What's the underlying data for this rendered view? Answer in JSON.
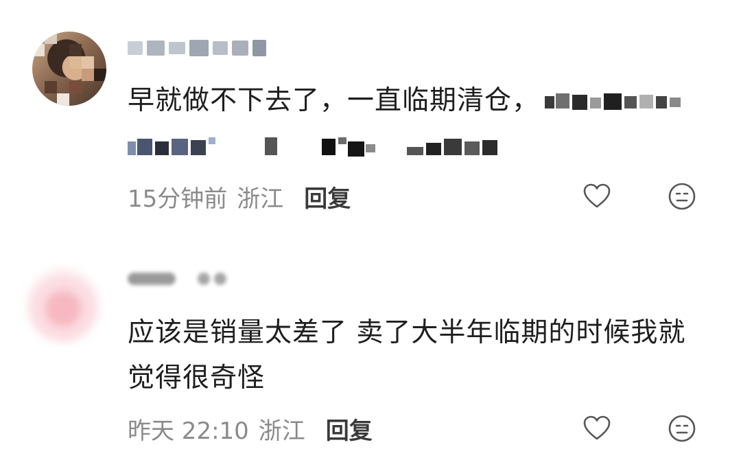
{
  "comments": [
    {
      "content_line1": "早就做不下去了，一直临期清仓，",
      "time": "15分钟前",
      "location": "浙江",
      "reply_label": "回复"
    },
    {
      "content_line1": "应该是销量太差了 卖了大半年临期的时候我就",
      "content_line2": "觉得很奇怪",
      "time": "昨天 22:10",
      "location": "浙江",
      "reply_label": "回复"
    }
  ],
  "icons": {
    "like": "heart-outline-icon",
    "react": "neutral-face-icon"
  },
  "colors": {
    "meta_text": "#8a8a8a",
    "reply_text": "#3a3a3a",
    "icon_stroke": "#555555"
  }
}
